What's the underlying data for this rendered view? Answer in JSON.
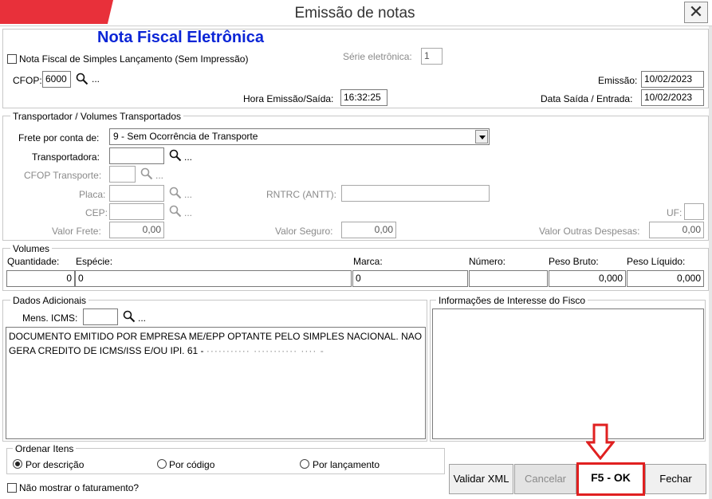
{
  "window": {
    "title": "Emissão de notas",
    "close_glyph": "✕",
    "accent_color": "#e8303a"
  },
  "header": {
    "nfe_title": "Nota Fiscal Eletrônica",
    "simples_checkbox_label": "Nota Fiscal de Simples Lançamento (Sem Impressão)",
    "simples_checked": false,
    "serie_label": "Série eletrônica:",
    "serie_value": "1",
    "cfop_label": "CFOP:",
    "cfop_value": "6000",
    "emissao_label": "Emissão:",
    "emissao_value": "10/02/2023",
    "hora_label": "Hora Emissão/Saída:",
    "hora_value": "16:32:25",
    "data_saida_label": "Data Saída / Entrada:",
    "data_saida_value": "10/02/2023"
  },
  "transport": {
    "legend": "Transportador /  Volumes Transportados",
    "frete_label": "Frete por conta de:",
    "frete_value": "9 - Sem Ocorrência de Transporte",
    "transportadora_label": "Transportadora:",
    "transportadora_value": "",
    "cfop_transporte_label": "CFOP Transporte:",
    "placa_label": "Placa:",
    "rntrc_label": "RNTRC (ANTT):",
    "cep_label": "CEP:",
    "uf_label": "UF:",
    "valor_frete_label": "Valor Frete:",
    "valor_frete_value": "0,00",
    "valor_seguro_label": "Valor Seguro:",
    "valor_seguro_value": "0,00",
    "valor_outras_label": "Valor Outras Despesas:",
    "valor_outras_value": "0,00"
  },
  "volumes": {
    "legend": "Volumes",
    "quantidade_label": "Quantidade:",
    "quantidade_value": "0",
    "especie_label": "Espécie:",
    "especie_value": "0",
    "marca_label": "Marca:",
    "marca_value": "0",
    "numero_label": "Número:",
    "numero_value": "",
    "peso_bruto_label": "Peso Bruto:",
    "peso_bruto_value": "0,000",
    "peso_liquido_label": "Peso Líquido:",
    "peso_liquido_value": "0,000"
  },
  "dados_adicionais": {
    "legend": "Dados Adicionais",
    "mens_icms_label": "Mens. ICMS:",
    "text": "DOCUMENTO EMITIDO POR EMPRESA ME/EPP OPTANTE PELO SIMPLES NACIONAL. NAO GERA CREDITO DE ICMS/ISS E/OU IPI. 61 - ",
    "redacted": "··········· ··········· ···· -"
  },
  "fisco": {
    "legend": "Informações de Interesse do Fisco"
  },
  "ordenar": {
    "legend": "Ordenar Itens",
    "options": [
      {
        "label": "Por descrição",
        "selected": true
      },
      {
        "label": "Por código",
        "selected": false
      },
      {
        "label": "Por lançamento",
        "selected": false
      }
    ]
  },
  "footer": {
    "nao_mostrar_label": "Não mostrar o faturamento?",
    "validar_label": "Validar XML",
    "cancelar_label": "Cancelar",
    "ok_label": "F5 - OK",
    "fechar_label": "Fechar",
    "highlight_color": "#e02020"
  },
  "ellipsis": "..."
}
